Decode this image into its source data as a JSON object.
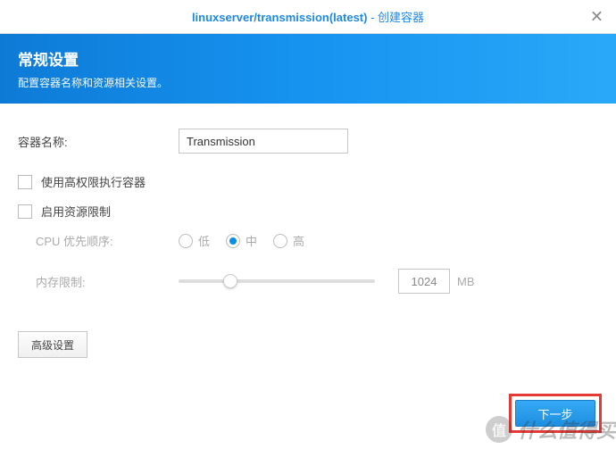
{
  "titlebar": {
    "image_name": "linuxserver/transmission(latest)",
    "separator": " - ",
    "action": "创建容器"
  },
  "banner": {
    "heading": "常规设置",
    "subheading": "配置容器名称和资源相关设置。"
  },
  "form": {
    "container_name_label": "容器名称:",
    "container_name_value": "Transmission",
    "high_priv_label": "使用高权限执行容器",
    "high_priv_checked": false,
    "resource_limit_label": "启用资源限制",
    "resource_limit_checked": false,
    "cpu_priority_label": "CPU 优先顺序:",
    "cpu_options": {
      "low": "低",
      "medium": "中",
      "high": "高"
    },
    "cpu_selected": "medium",
    "memory_limit_label": "内存限制:",
    "memory_value": "1024",
    "memory_unit": "MB",
    "advanced_button": "高级设置"
  },
  "footer": {
    "next_button": "下一步"
  },
  "watermark": {
    "badge": "值",
    "text": "什么值得买"
  }
}
